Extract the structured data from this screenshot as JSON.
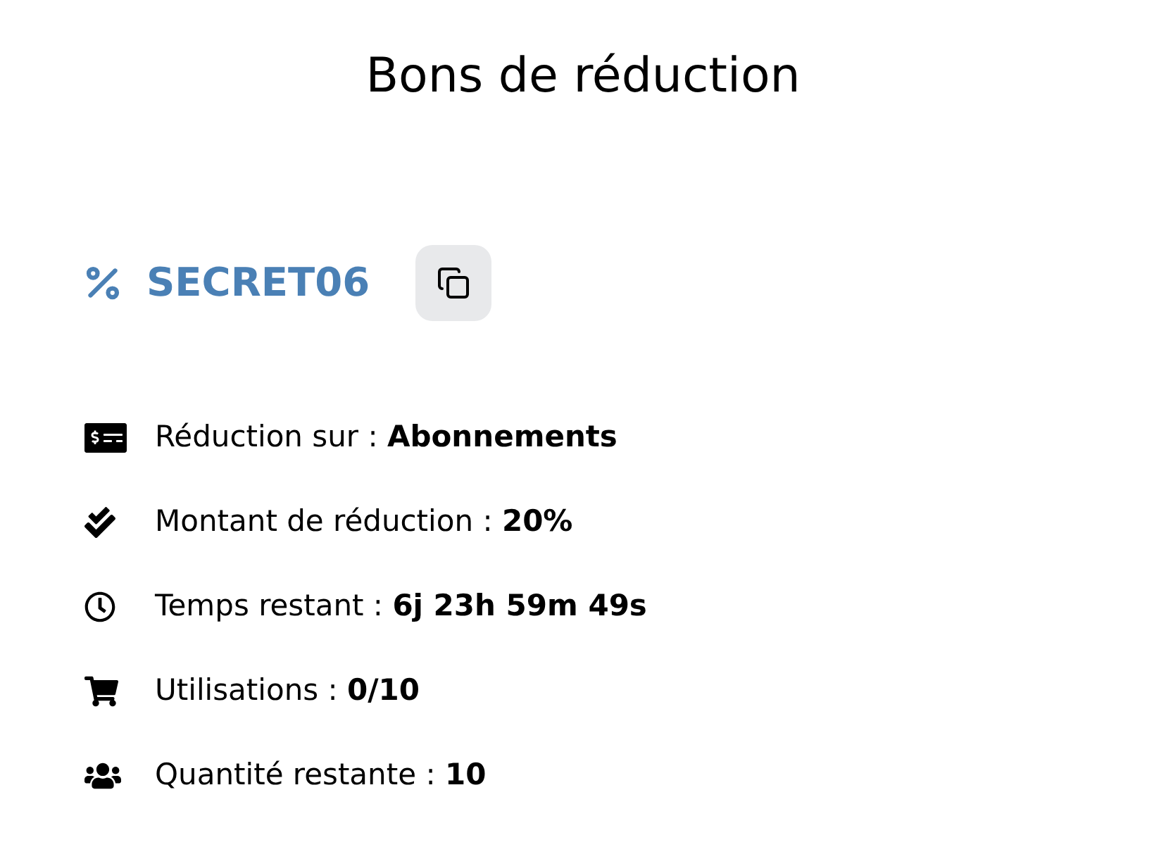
{
  "title": "Bons de réduction",
  "coupon": {
    "code": "SECRET06"
  },
  "details": [
    {
      "kind": "target",
      "text": "Réduction sur : **Abonnements**"
    },
    {
      "kind": "amount",
      "text": "Montant de réduction : **20%**"
    },
    {
      "kind": "time",
      "text": "Temps restant : **6j 23h 59m 49s**"
    },
    {
      "kind": "uses",
      "text": "Utilisations : **0/10**"
    },
    {
      "kind": "remaining",
      "text": "Quantité restante : **10**"
    }
  ]
}
